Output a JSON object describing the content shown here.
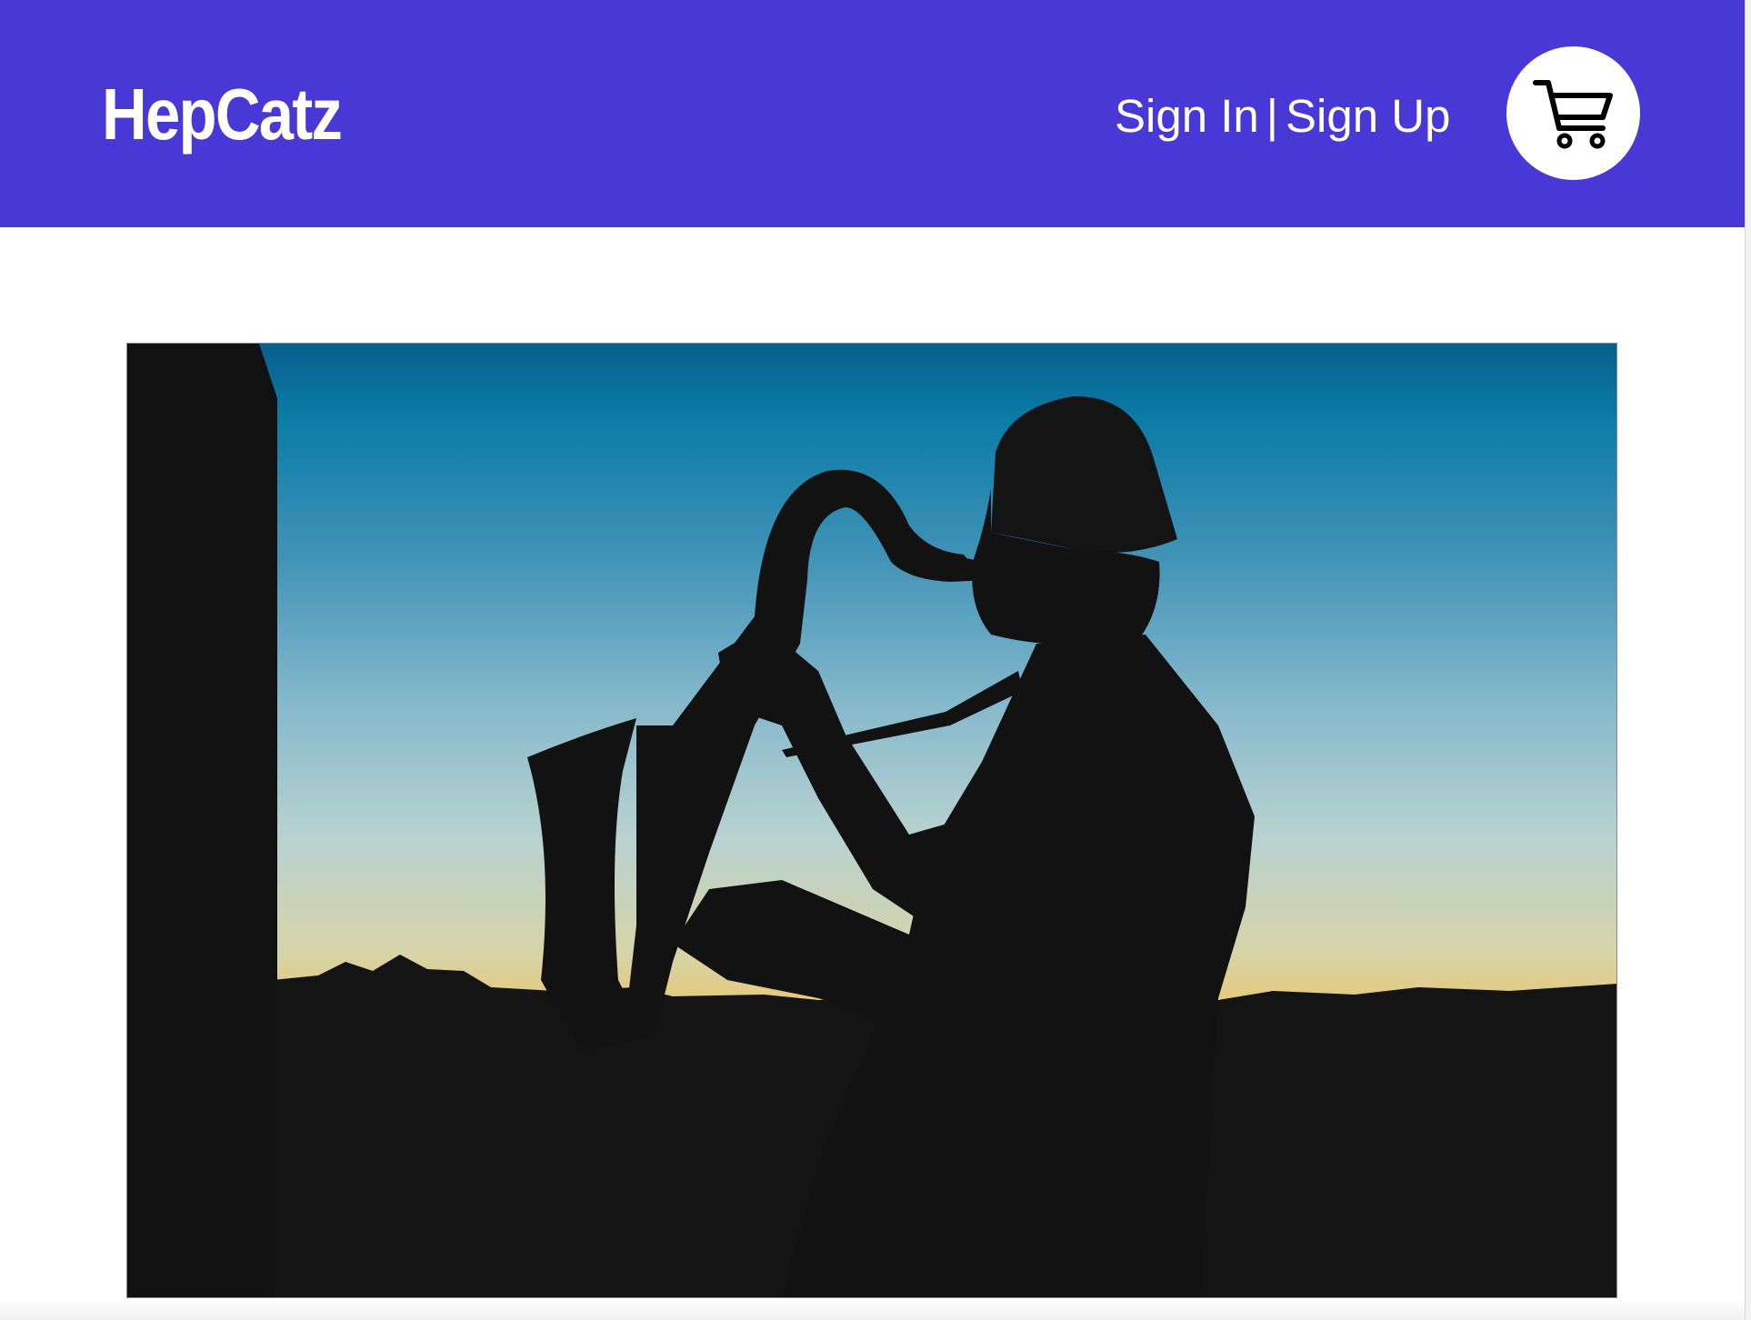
{
  "header": {
    "brand": "HepCatz",
    "sign_in_label": "Sign In",
    "separator": "|",
    "sign_up_label": "Sign Up",
    "cart_icon": "shopping-cart-icon",
    "background_color": "#4839d6"
  },
  "hero": {
    "image_icon": "saxophone-player-silhouette-sunset"
  }
}
